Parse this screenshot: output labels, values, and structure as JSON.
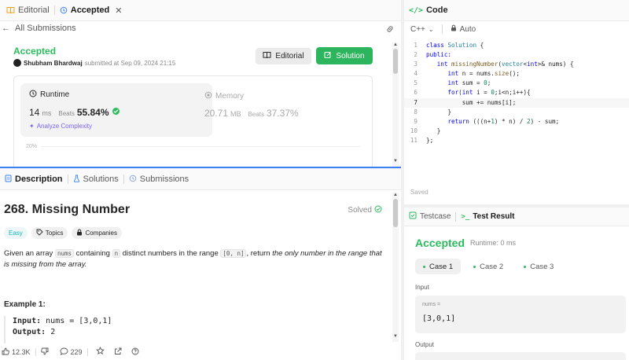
{
  "left_top": {
    "tabs": [
      {
        "label": "Editorial",
        "icon": "book-icon"
      },
      {
        "label": "Accepted",
        "icon": "history-icon"
      }
    ],
    "back_label": "All Submissions",
    "status": "Accepted",
    "author": "Shubham Bhardwaj",
    "submitted_text": "submitted at Sep 09, 2024 21:15",
    "editorial_button": "Editorial",
    "solution_button": "Solution",
    "runtime": {
      "label": "Runtime",
      "value": "14",
      "unit": "ms",
      "beats_label": "Beats",
      "beats": "55.84%",
      "analyze": "Analyze Complexity"
    },
    "memory": {
      "label": "Memory",
      "value": "20.71",
      "unit": "MB",
      "beats_label": "Beats",
      "beats": "37.37%"
    },
    "chart_tick": "20%"
  },
  "description": {
    "tabs": [
      {
        "label": "Description",
        "icon": "document-icon"
      },
      {
        "label": "Solutions",
        "icon": "flask-icon"
      },
      {
        "label": "Submissions",
        "icon": "history-icon"
      }
    ],
    "title": "268. Missing Number",
    "solved": "Solved",
    "tags": [
      "Easy",
      "Topics",
      "Companies"
    ],
    "para": {
      "p1": "Given an array",
      "c1": "nums",
      "p2": "containing",
      "c2": "n",
      "p3": "distinct numbers in the range",
      "c3": "[0, n]",
      "p4": ", return",
      "emph": "the only number in the range that is missing from the array."
    },
    "example_title": "Example 1:",
    "example_input_label": "Input:",
    "example_input": "nums = [3,0,1]",
    "example_output_label": "Output:",
    "example_output": "2",
    "footer": {
      "likes": "12.3K",
      "comments": "229"
    }
  },
  "code": {
    "tab_label": "Code",
    "language": "C++",
    "mode": "Auto",
    "saved": "Saved",
    "lines": [
      {
        "n": "1"
      },
      {
        "n": "2"
      },
      {
        "n": "3"
      },
      {
        "n": "4"
      },
      {
        "n": "5"
      },
      {
        "n": "6"
      },
      {
        "n": "7"
      },
      {
        "n": "8"
      },
      {
        "n": "9"
      },
      {
        "n": "10"
      },
      {
        "n": "11"
      }
    ],
    "l1a": "class ",
    "l1b": "Solution",
    "l1c": " {",
    "l2": "public:",
    "l3a": "int ",
    "l3b": "missingNumber",
    "l3c": "(",
    "l3d": "vector",
    "l3e": "<",
    "l3f": "int",
    "l3g": ">& nums) {",
    "l4a": "int ",
    "l4b": "n = nums.",
    "l4c": "size",
    "l4d": "();",
    "l5a": "int ",
    "l5b": "sum = ",
    "l5c": "0",
    "l5d": ";",
    "l6a": "for",
    "l6b": "(",
    "l6c": "int ",
    "l6d": "i = ",
    "l6e": "0",
    "l6f": ";i<n;i++){",
    "l7": "sum += nums[i];",
    "l8": "}",
    "l9a": "return ",
    "l9b": "(((n+",
    "l9c": "1",
    "l9d": ") * n) / ",
    "l9e": "2",
    "l9f": ") - sum;",
    "l10": "}",
    "l11": "};"
  },
  "test": {
    "tabs": [
      "Testcase",
      "Test Result"
    ],
    "status": "Accepted",
    "runtime": "Runtime: 0 ms",
    "cases": [
      "Case 1",
      "Case 2",
      "Case 3"
    ],
    "input_label": "Input",
    "input_name": "nums =",
    "input_value": "[3,0,1]",
    "output_label": "Output"
  },
  "colors": {
    "accent_green": "#2cbb5d",
    "link_blue": "#3b82f6"
  }
}
